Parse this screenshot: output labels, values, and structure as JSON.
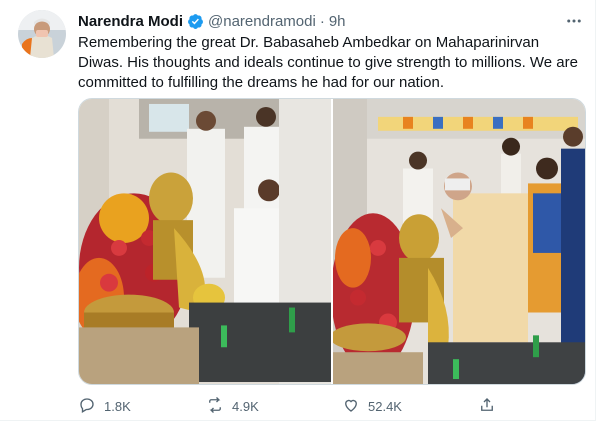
{
  "tweet": {
    "author_name": "Narendra Modi",
    "author_handle": "@narendramodi",
    "separator": "·",
    "time": "9h",
    "text": "Remembering the great Dr. Babasaheb Ambedkar on Mahaparinirvan Diwas. His thoughts and ideals continue to give strength to millions. We are committed to fulfilling the dreams he had for our nation.",
    "actions": {
      "reply_count": "1.8K",
      "retweet_count": "4.9K",
      "like_count": "52.4K"
    },
    "icons": {
      "verified": "verified-badge-icon",
      "more": "more-icon",
      "reply": "reply-icon",
      "retweet": "retweet-icon",
      "like": "like-icon",
      "share": "share-icon"
    }
  },
  "colors": {
    "verified": "#1d9bf0",
    "secondary_text": "#536471",
    "primary_text": "#0f1419"
  }
}
